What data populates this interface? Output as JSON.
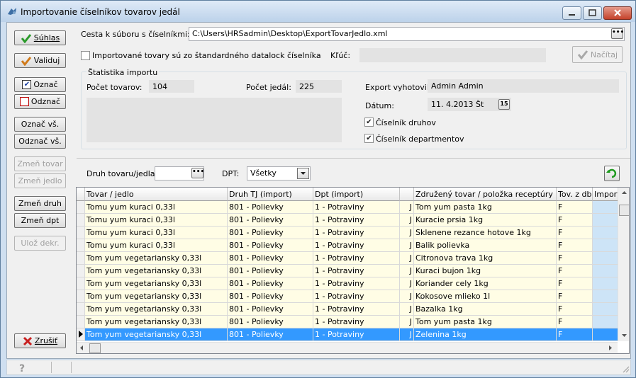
{
  "window": {
    "title": "Importovanie číselníkov tovarov jedál"
  },
  "left_buttons": {
    "confirm": "Súhlas",
    "validate": "Validuj",
    "mark": "Označ",
    "unmark": "Odznač",
    "mark_all": "Označ vš.",
    "unmark_all": "Odznač vš.",
    "change_item": "Zmeň tovar",
    "change_meal": "Zmeň jedlo",
    "change_type": "Zmeň druh",
    "change_dpt": "Zmeň dpt",
    "save_dekr": "Ulož dekr.",
    "cancel": "Zrušiť"
  },
  "path": {
    "label": "Cesta k súboru s číselníkmi:",
    "value": "C:\\Users\\HRSadmin\\Desktop\\ExportTovarJedlo.xml"
  },
  "standard": {
    "label": "Importované tovary sú zo štandardného datalock číselníka",
    "checked": false
  },
  "key": {
    "label": "Kľúč:",
    "value": ""
  },
  "load_button": "Načítaj",
  "stats": {
    "title": "Štatistika importu",
    "items_label": "Počet tovarov:",
    "items_value": "104",
    "meals_label": "Počet jedál:",
    "meals_value": "225"
  },
  "export": {
    "by_label": "Export vyhotovil:",
    "by_value": "Admin Admin",
    "date_label": "Dátum:",
    "date_value": "11. 4.2013  Št",
    "date_icon": "15",
    "types_label": "Číselník druhov",
    "types_checked": true,
    "depts_label": "Číselník departmentov",
    "depts_checked": true
  },
  "filter": {
    "type_label": "Druh tovaru/jedla:",
    "type_value": "",
    "dpt_label": "DPT:",
    "dpt_value": "Všetky"
  },
  "grid": {
    "columns": [
      "Tovar / jedlo",
      "Druh TJ (import)",
      "Dpt (import)",
      "",
      "Združený tovar / položka receptúry",
      "Tov. z db",
      "Import"
    ],
    "rows": [
      [
        "Tomu yum kuraci 0,33l",
        "801 - Polievky",
        "1 - Potraviny",
        "J",
        "Tom yum pasta 1kg",
        "F",
        ""
      ],
      [
        "Tomu yum kuraci 0,33l",
        "801 - Polievky",
        "1 - Potraviny",
        "J",
        "Kuracie prsia 1kg",
        "F",
        ""
      ],
      [
        "Tomu yum kuraci 0,33l",
        "801 - Polievky",
        "1 - Potraviny",
        "J",
        "Sklenene rezance hotove 1kg",
        "F",
        ""
      ],
      [
        "Tomu yum kuraci 0,33l",
        "801 - Polievky",
        "1 - Potraviny",
        "J",
        "Balik polievka",
        "F",
        ""
      ],
      [
        "Tom yum vegetariansky 0,33l",
        "801 - Polievky",
        "1 - Potraviny",
        "J",
        "Citronova trava 1kg",
        "F",
        ""
      ],
      [
        "Tom yum vegetariansky 0,33l",
        "801 - Polievky",
        "1 - Potraviny",
        "J",
        "Kuraci bujon 1kg",
        "F",
        ""
      ],
      [
        "Tom yum vegetariansky 0,33l",
        "801 - Polievky",
        "1 - Potraviny",
        "J",
        "Koriander cely 1kg",
        "F",
        ""
      ],
      [
        "Tom yum vegetariansky 0,33l",
        "801 - Polievky",
        "1 - Potraviny",
        "J",
        "Kokosove mlieko 1l",
        "F",
        ""
      ],
      [
        "Tom yum vegetariansky 0,33l",
        "801 - Polievky",
        "1 - Potraviny",
        "J",
        "Bazalka 1kg",
        "F",
        ""
      ],
      [
        "Tom yum vegetariansky 0,33l",
        "801 - Polievky",
        "1 - Potraviny",
        "J",
        "Tom yum pasta 1kg",
        "F",
        ""
      ],
      [
        "Tom yum vegetariansky 0,33l",
        "801 - Polievky",
        "1 - Potraviny",
        "J",
        "Zelenina 1kg",
        "F",
        ""
      ]
    ],
    "selected_row": 10
  }
}
